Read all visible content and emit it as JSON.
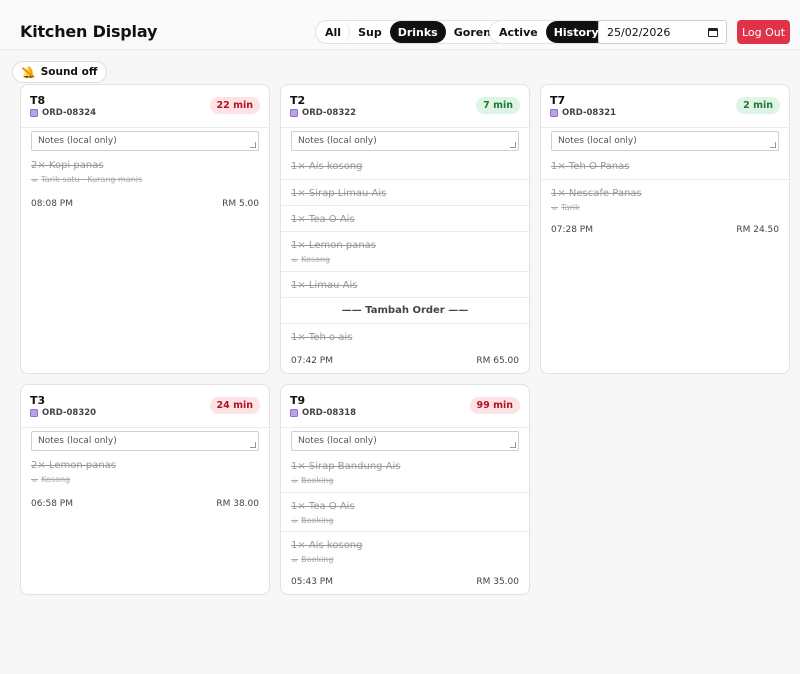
{
  "app": {
    "title": "Kitchen Display"
  },
  "filters": {
    "all": "All",
    "sup": "Sup",
    "drinks": "Drinks",
    "goreng": "Goreng",
    "selected": "Drinks"
  },
  "views": {
    "active": "Active",
    "history": "History",
    "selected": "History"
  },
  "date": {
    "value": "25/02/2026"
  },
  "logout": {
    "label": "Log Out"
  },
  "sound": {
    "label": "Sound off",
    "icon": "sound-off-icon"
  },
  "notes_placeholder": "Notes (local only)",
  "colors": {
    "accent": "#111111",
    "logout": "#e0334a",
    "late": "#b3121f",
    "ok": "#1b7a35"
  },
  "orders": [
    {
      "table": "T8",
      "order_no": "ORD-08324",
      "elapsed": "22 min",
      "status": "red",
      "items": [
        {
          "name": "2× Kopi panas",
          "mods": "Tarik satu · Kurang manis"
        }
      ],
      "time": "08:08 PM",
      "total": "RM 5.00"
    },
    {
      "table": "T2",
      "order_no": "ORD-08322",
      "elapsed": "7 min",
      "status": "green",
      "items": [
        {
          "name": "1× Ais kosong"
        },
        {
          "name": "1× Sirap Limau Ais"
        },
        {
          "name": "1× Tea O Ais"
        },
        {
          "name": "1× Lemon panas",
          "mods": "Kosong"
        },
        {
          "name": "1× Limau Ais"
        }
      ],
      "divider": "—— Tambah Order ——",
      "extra_items": [
        {
          "name": "1× Teh o ais"
        }
      ],
      "time": "07:42 PM",
      "total": "RM 65.00"
    },
    {
      "table": "T7",
      "order_no": "ORD-08321",
      "elapsed": "2 min",
      "status": "green",
      "items": [
        {
          "name": "1× Teh O Panas"
        },
        {
          "name": "1× Nescafe Panas",
          "mods": "Tarik"
        }
      ],
      "time": "07:28 PM",
      "total": "RM 24.50"
    },
    {
      "table": "T3",
      "order_no": "ORD-08320",
      "elapsed": "24 min",
      "status": "red",
      "items": [
        {
          "name": "2× Lemon panas",
          "mods": "Kosong"
        }
      ],
      "time": "06:58 PM",
      "total": "RM 38.00"
    },
    {
      "table": "T9",
      "order_no": "ORD-08318",
      "elapsed": "99 min",
      "status": "red",
      "items": [
        {
          "name": "1× Sirap Bandung Ais",
          "mods": "Booking"
        },
        {
          "name": "1× Tea O Ais",
          "mods": "Booking"
        },
        {
          "name": "1× Ais kosong",
          "mods": "Booking"
        }
      ],
      "time": "05:43 PM",
      "total": "RM 35.00"
    }
  ]
}
